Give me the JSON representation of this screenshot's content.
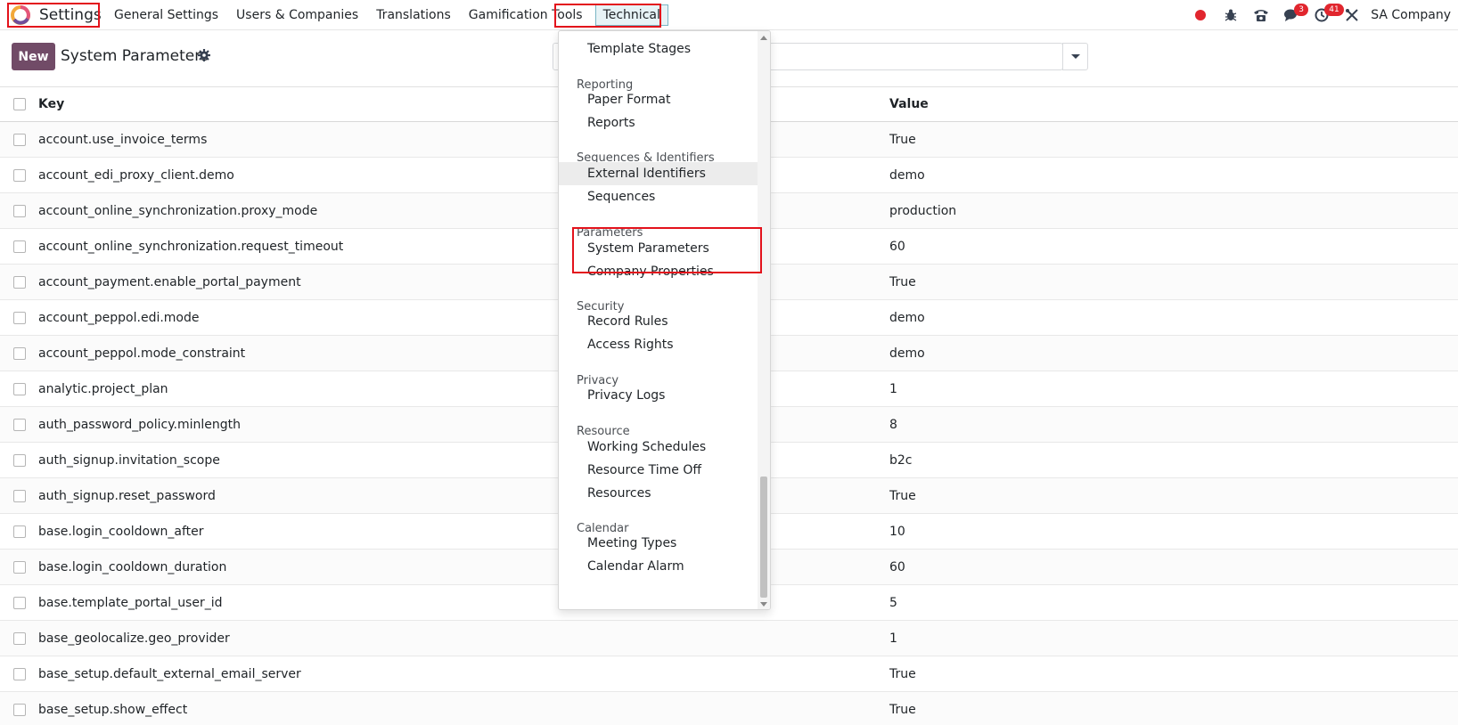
{
  "navbar": {
    "app_title": "Settings",
    "menu": [
      {
        "label": "General Settings"
      },
      {
        "label": "Users & Companies"
      },
      {
        "label": "Translations"
      },
      {
        "label": "Gamification Tools"
      },
      {
        "label": "Technical",
        "active": true
      }
    ],
    "systray": {
      "messages_badge": "3",
      "activities_badge": "41",
      "company": "SA Company"
    }
  },
  "control_panel": {
    "new_label": "New",
    "page_title": "System Parameters",
    "search_placeholder": ""
  },
  "list": {
    "columns": {
      "key": "Key",
      "value": "Value"
    },
    "rows": [
      {
        "key": "account.use_invoice_terms",
        "value": "True"
      },
      {
        "key": "account_edi_proxy_client.demo",
        "value": "demo"
      },
      {
        "key": "account_online_synchronization.proxy_mode",
        "value": "production"
      },
      {
        "key": "account_online_synchronization.request_timeout",
        "value": "60"
      },
      {
        "key": "account_payment.enable_portal_payment",
        "value": "True"
      },
      {
        "key": "account_peppol.edi.mode",
        "value": "demo"
      },
      {
        "key": "account_peppol.mode_constraint",
        "value": "demo"
      },
      {
        "key": "analytic.project_plan",
        "value": "1"
      },
      {
        "key": "auth_password_policy.minlength",
        "value": "8"
      },
      {
        "key": "auth_signup.invitation_scope",
        "value": "b2c"
      },
      {
        "key": "auth_signup.reset_password",
        "value": "True"
      },
      {
        "key": "base.login_cooldown_after",
        "value": "10"
      },
      {
        "key": "base.login_cooldown_duration",
        "value": "60"
      },
      {
        "key": "base.template_portal_user_id",
        "value": "5"
      },
      {
        "key": "base_geolocalize.geo_provider",
        "value": "1"
      },
      {
        "key": "base_setup.default_external_email_server",
        "value": "True"
      },
      {
        "key": "base_setup.show_effect",
        "value": "True"
      }
    ]
  },
  "technical_dropdown": {
    "partial_top_item": "Template Stages",
    "sections": [
      {
        "header": "Reporting",
        "items": [
          "Paper Format",
          "Reports"
        ]
      },
      {
        "header": "Sequences & Identifiers",
        "items": [
          "External Identifiers",
          "Sequences"
        ]
      },
      {
        "header": "Parameters",
        "items": [
          "System Parameters",
          "Company Properties"
        ]
      },
      {
        "header": "Security",
        "items": [
          "Record Rules",
          "Access Rights"
        ]
      },
      {
        "header": "Privacy",
        "items": [
          "Privacy Logs"
        ]
      },
      {
        "header": "Resource",
        "items": [
          "Working Schedules",
          "Resource Time Off",
          "Resources"
        ]
      },
      {
        "header": "Calendar",
        "items": [
          "Meeting Types",
          "Calendar Alarm"
        ]
      }
    ],
    "hovered_item": "External Identifiers"
  },
  "colors": {
    "brand": "#714b67",
    "annotation": "#e3121b",
    "badge": "#e1262e"
  }
}
